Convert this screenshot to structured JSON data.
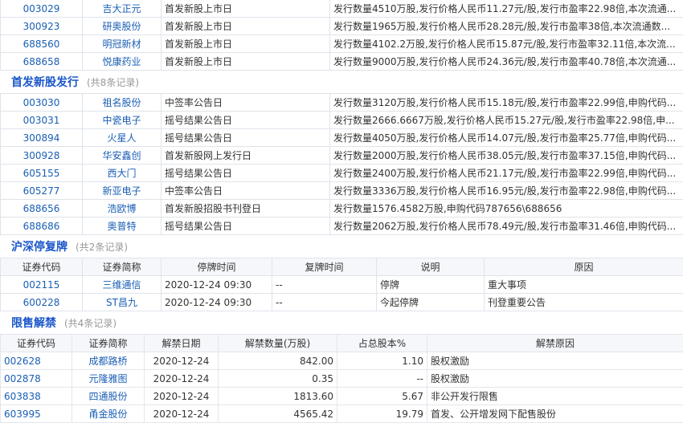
{
  "ipo_listing": {
    "rows": [
      {
        "code": "003029",
        "name": "吉大正元",
        "event": "首发新股上市日",
        "detail": "发行数量4510万股,发行价格人民币11.27元/股,发行市盈率22.98倍,本次流通..."
      },
      {
        "code": "300923",
        "name": "研奥股份",
        "event": "首发新股上市日",
        "detail": "发行数量1965万股,发行价格人民币28.28元/股,发行市盈率38倍,本次流通数..."
      },
      {
        "code": "688560",
        "name": "明冠新材",
        "event": "首发新股上市日",
        "detail": "发行数量4102.2万股,发行价格人民币15.87元/股,发行市盈率32.11倍,本次流..."
      },
      {
        "code": "688658",
        "name": "悦康药业",
        "event": "首发新股上市日",
        "detail": "发行数量9000万股,发行价格人民币24.36元/股,发行市盈率40.78倍,本次流通..."
      }
    ]
  },
  "ipo_issue": {
    "title": "首发新股发行",
    "count": "(共8条记录)",
    "rows": [
      {
        "code": "003030",
        "name": "祖名股份",
        "event": "中签率公告日",
        "detail": "发行数量3120万股,发行价格人民币15.18元/股,发行市盈率22.99倍,申购代码..."
      },
      {
        "code": "003031",
        "name": "中瓷电子",
        "event": "摇号结果公告日",
        "detail": "发行数量2666.6667万股,发行价格人民币15.27元/股,发行市盈率22.98倍,申..."
      },
      {
        "code": "300894",
        "name": "火星人",
        "event": "摇号结果公告日",
        "detail": "发行数量4050万股,发行价格人民币14.07元/股,发行市盈率25.77倍,申购代码..."
      },
      {
        "code": "300928",
        "name": "华安鑫创",
        "event": "首发新股网上发行日",
        "detail": "发行数量2000万股,发行价格人民币38.05元/股,发行市盈率37.15倍,申购代码..."
      },
      {
        "code": "605155",
        "name": "西大门",
        "event": "摇号结果公告日",
        "detail": "发行数量2400万股,发行价格人民币21.17元/股,发行市盈率22.99倍,申购代码..."
      },
      {
        "code": "605277",
        "name": "新亚电子",
        "event": "中签率公告日",
        "detail": "发行数量3336万股,发行价格人民币16.95元/股,发行市盈率22.98倍,申购代码..."
      },
      {
        "code": "688656",
        "name": "浩欧博",
        "event": "首发新股招股书刊登日",
        "detail": "发行数量1576.4582万股,申购代码787656\\688656"
      },
      {
        "code": "688686",
        "name": "奥普特",
        "event": "摇号结果公告日",
        "detail": "发行数量2062万股,发行价格人民币78.49元/股,发行市盈率31.46倍,申购代码..."
      }
    ]
  },
  "suspension": {
    "title": "沪深停复牌",
    "count": "(共2条记录)",
    "headers": [
      "证券代码",
      "证券简称",
      "停牌时间",
      "复牌时间",
      "说明",
      "原因"
    ],
    "rows": [
      {
        "code": "002115",
        "name": "三维通信",
        "stop": "2020-12-24 09:30",
        "resume": "--",
        "note": "停牌",
        "reason": "重大事项"
      },
      {
        "code": "600228",
        "name": "ST昌九",
        "stop": "2020-12-24 09:30",
        "resume": "--",
        "note": "今起停牌",
        "reason": "刊登重要公告"
      }
    ]
  },
  "unlock": {
    "title": "限售解禁",
    "count": "(共4条记录)",
    "headers": [
      "证券代码",
      "证券简称",
      "解禁日期",
      "解禁数量(万股)",
      "占总股本%",
      "解禁原因"
    ],
    "rows": [
      {
        "code": "002628",
        "name": "成都路桥",
        "date": "2020-12-24",
        "qty": "842.00",
        "pct": "1.10",
        "reason": "股权激励"
      },
      {
        "code": "002878",
        "name": "元隆雅图",
        "date": "2020-12-24",
        "qty": "0.35",
        "pct": "--",
        "reason": "股权激励"
      },
      {
        "code": "603838",
        "name": "四通股份",
        "date": "2020-12-24",
        "qty": "1813.60",
        "pct": "5.67",
        "reason": "非公开发行限售"
      },
      {
        "code": "603995",
        "name": "甬金股份",
        "date": "2020-12-24",
        "qty": "4565.42",
        "pct": "19.79",
        "reason": "首发、公开增发网下配售股份"
      }
    ]
  }
}
